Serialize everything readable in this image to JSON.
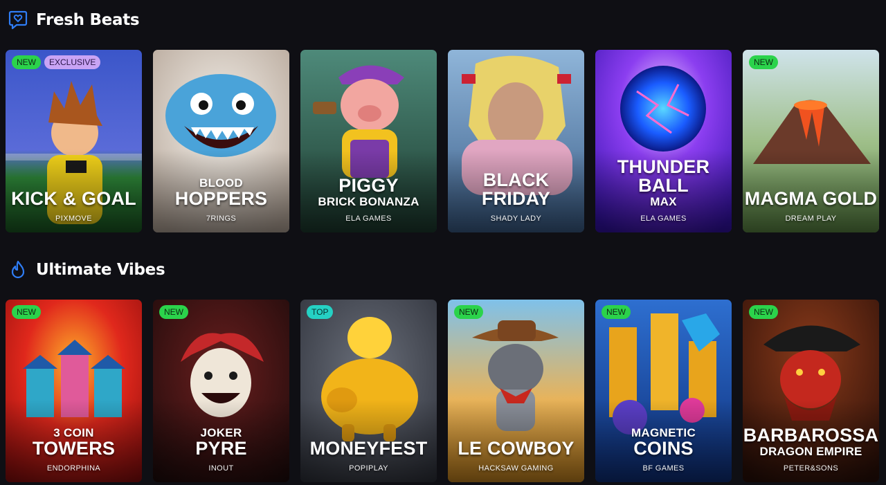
{
  "sections": [
    {
      "title": "Fresh Beats",
      "icon": "heart-chat-icon",
      "games": [
        {
          "badges": [
            "NEW",
            "EXCLUSIVE"
          ],
          "pre": "",
          "title": "KICK & GOAL",
          "sub": "",
          "provider": "PIXMOVE"
        },
        {
          "badges": [],
          "pre": "BLOOD",
          "title": "HOPPERS",
          "sub": "",
          "provider": "7RINGS"
        },
        {
          "badges": [],
          "pre": "",
          "title": "PIGGY",
          "sub": "BRICK BONANZA",
          "provider": "ELA GAMES"
        },
        {
          "badges": [],
          "pre": "",
          "title": "BLACK FRIDAY",
          "sub": "",
          "provider": "SHADY LADY"
        },
        {
          "badges": [],
          "pre": "",
          "title": "THUNDER BALL",
          "sub": "MAX",
          "provider": "ELA GAMES"
        },
        {
          "badges": [
            "NEW"
          ],
          "pre": "",
          "title": "MAGMA GOLD",
          "sub": "",
          "provider": "DREAM PLAY"
        }
      ]
    },
    {
      "title": "Ultimate Vibes",
      "icon": "flame-icon",
      "games": [
        {
          "badges": [
            "NEW"
          ],
          "pre": "3 COIN",
          "title": "TOWERS",
          "sub": "",
          "provider": "ENDORPHINA"
        },
        {
          "badges": [
            "NEW"
          ],
          "pre": "JOKER",
          "title": "PYRE",
          "sub": "",
          "provider": "INOUT"
        },
        {
          "badges": [
            "TOP"
          ],
          "pre": "",
          "title": "MONEYFEST",
          "sub": "",
          "provider": "POPIPLAY"
        },
        {
          "badges": [
            "NEW"
          ],
          "pre": "",
          "title": "LE COWBOY",
          "sub": "",
          "provider": "HACKSAW GAMING"
        },
        {
          "badges": [
            "NEW"
          ],
          "pre": "MAGNETIC",
          "title": "COINS",
          "sub": "",
          "provider": "BF GAMES"
        },
        {
          "badges": [
            "NEW"
          ],
          "pre": "",
          "title": "BARBAROSSA",
          "sub": "DRAGON EMPIRE",
          "provider": "PETER&SONS"
        }
      ]
    }
  ],
  "colors": {
    "background": "#0f0f14",
    "accent_icon": "#2f7df6",
    "badge_new": "#2bd34b",
    "badge_exclusive": "#c9a4f5",
    "badge_top": "#25d1c4"
  }
}
